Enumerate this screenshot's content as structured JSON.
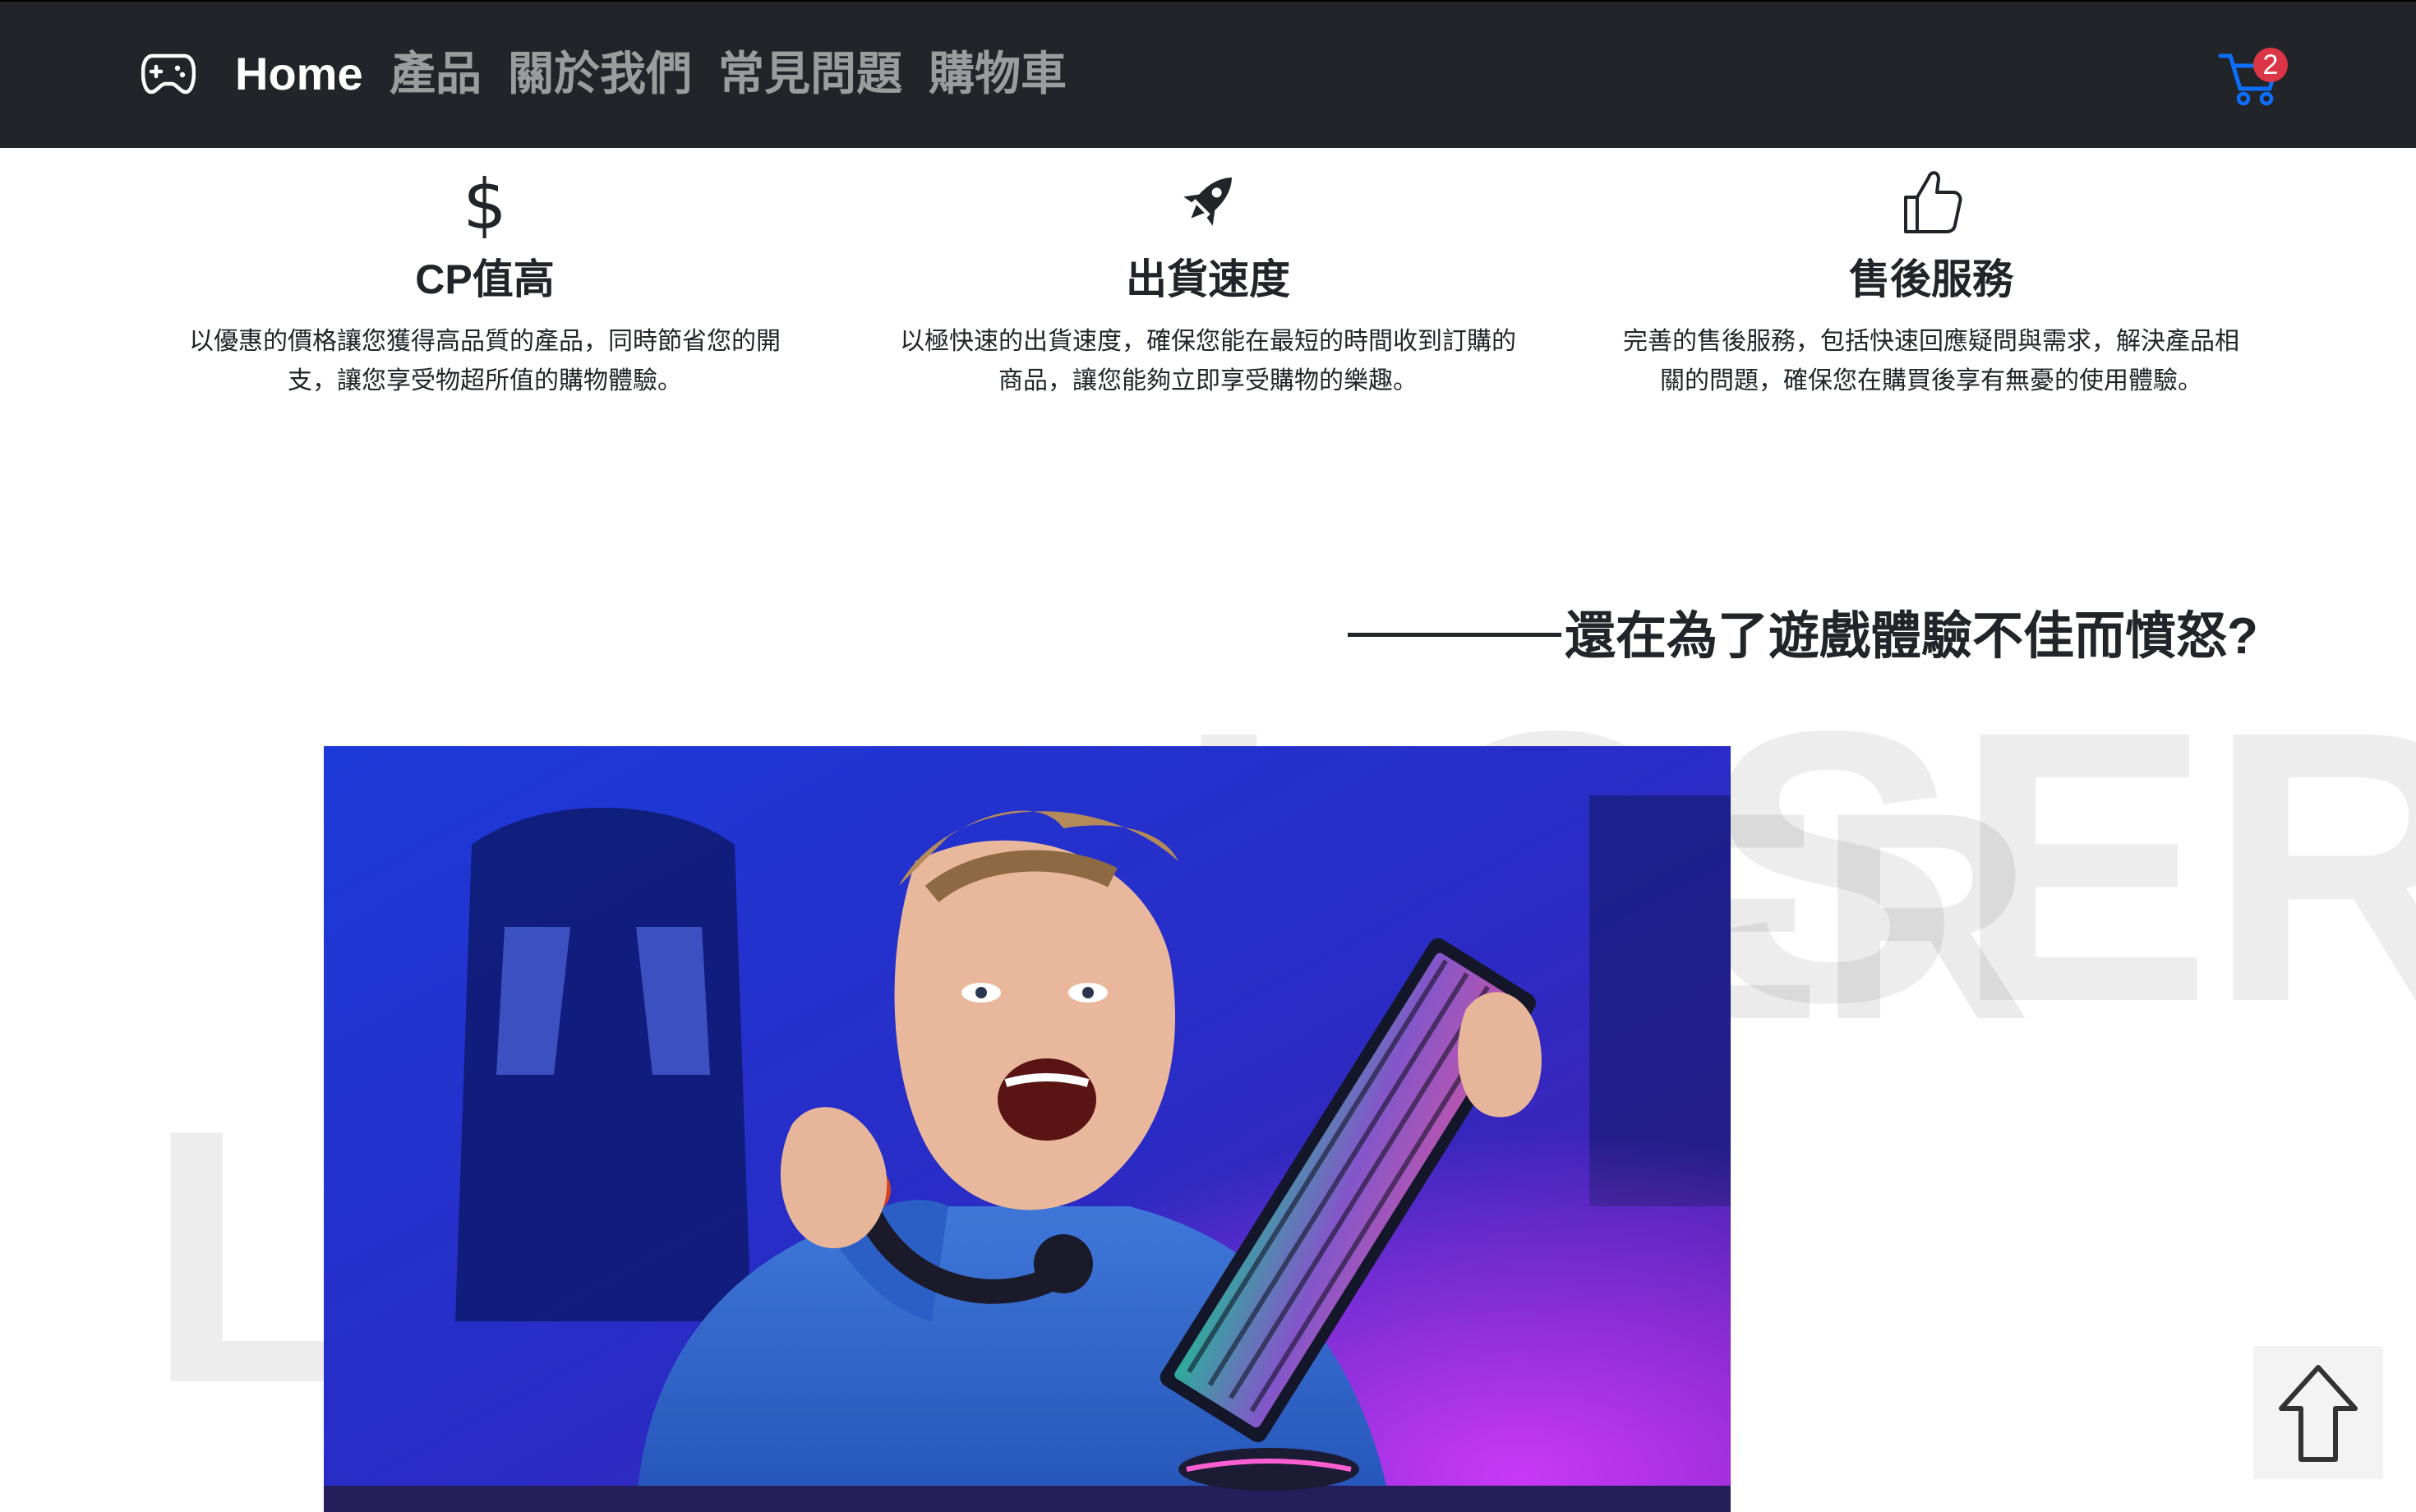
{
  "navbar": {
    "brand_icon": "gamepad-icon",
    "links": [
      "Home",
      "產品",
      "關於我們",
      "常見問題",
      "購物車"
    ],
    "cart_icon": "cart-icon",
    "cart_count": "2",
    "colors": {
      "background": "#212529",
      "badge": "#dc3545",
      "cart": "#0d6efd"
    }
  },
  "features": [
    {
      "icon": "dollar-icon",
      "title": "CP值高",
      "desc": "以優惠的價格讓您獲得高品質的產品，同時節省您的開支，讓您享受物超所值的購物體驗。"
    },
    {
      "icon": "rocket-icon",
      "title": "出貨速度",
      "desc": "以極快速的出貨速度，確保您能在最短的時間收到訂購的商品，讓您能夠立即享受購物的樂趣。"
    },
    {
      "icon": "thumbs-up-icon",
      "title": "售後服務",
      "desc": "完善的售後服務，包括快速回應疑問與需求，解決產品相關的問題，確保您在購買後享有無憂的使用體驗。"
    }
  ],
  "headline": "還在為了遊戲體驗不佳而憤怒?",
  "watermark": {
    "main": "LOSER",
    "second": "SER",
    "letter": "L"
  },
  "hero_image": "angry-gamer-photo",
  "back_to_top_icon": "arrow-up-icon"
}
